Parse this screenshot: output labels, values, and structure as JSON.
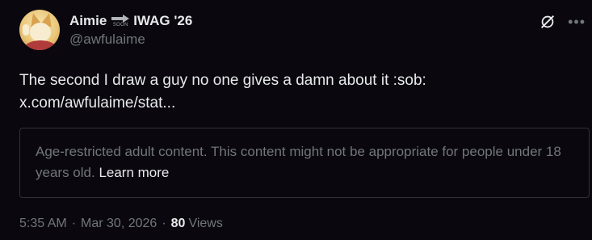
{
  "author": {
    "display_name_prefix": "Aimie",
    "badge_text": "SOON",
    "display_name_suffix": "IWAG '26",
    "handle": "@awfulaime"
  },
  "tweet": {
    "text": "The second I draw a guy no one gives a damn about it :sob:",
    "link": "x.com/awfulaime/stat..."
  },
  "warning": {
    "text": "Age-restricted adult content. This content might not be appropriate for people under 18 years old.",
    "learn_more": "Learn more"
  },
  "footer": {
    "time": "5:35 AM",
    "date": "Mar 30, 2026",
    "separator": "·",
    "views_count": "80",
    "views_label": "Views"
  },
  "icons": {
    "x_logo": "x-logo-icon",
    "more": "more-options-icon"
  },
  "colors": {
    "background": "#0a070f",
    "text_primary": "#e7e9ea",
    "text_secondary": "#71767b",
    "border": "#2f3336"
  }
}
